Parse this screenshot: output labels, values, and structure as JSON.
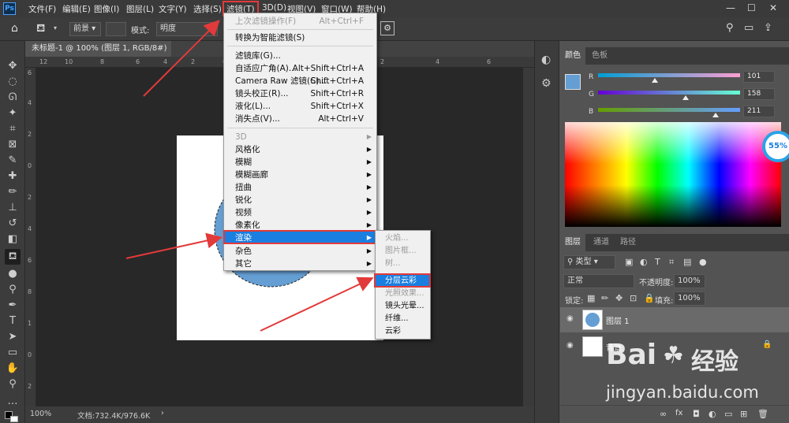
{
  "app": {
    "logo": "Ps"
  },
  "menubar": {
    "items": [
      "文件(F)",
      "编辑(E)",
      "图像(I)",
      "图层(L)",
      "文字(Y)",
      "选择(S)",
      "滤镜(T)",
      "3D(D)",
      "视图(V)",
      "窗口(W)",
      "帮助(H)"
    ],
    "window_controls": [
      "—",
      "☐",
      "✕"
    ]
  },
  "options": {
    "source_value": "前景",
    "mode_label": "模式:",
    "mode_value": "明度"
  },
  "document": {
    "tab_title": "未标题-1 @ 100% (图层 1, RGB/8#) *",
    "zoom": "100%",
    "doc_info": "文档:732.4K/976.6K",
    "ruler_h": [
      "12",
      "10",
      "8",
      "6",
      "4",
      "2",
      "0",
      "2",
      "4",
      "6"
    ],
    "ruler_v": [
      "6",
      "4",
      "2",
      "0",
      "2",
      "4",
      "6",
      "8",
      "1",
      "0",
      "2"
    ]
  },
  "filter_menu": {
    "items": [
      {
        "label": "上次滤镜操作(F)",
        "shortcut": "Alt+Ctrl+F",
        "disabled": true
      },
      {
        "label": "转换为智能滤镜(S)",
        "shortcut": ""
      },
      {
        "label": "滤镜库(G)...",
        "shortcut": ""
      },
      {
        "label": "自适应广角(A)...",
        "shortcut": "Alt+Shift+Ctrl+A"
      },
      {
        "label": "Camera Raw 滤镜(C)...",
        "shortcut": "Shift+Ctrl+A"
      },
      {
        "label": "镜头校正(R)...",
        "shortcut": "Shift+Ctrl+R"
      },
      {
        "label": "液化(L)...",
        "shortcut": "Shift+Ctrl+X"
      },
      {
        "label": "消失点(V)...",
        "shortcut": "Alt+Ctrl+V"
      },
      {
        "label": "3D",
        "disabled": true
      },
      {
        "label": "风格化"
      },
      {
        "label": "模糊"
      },
      {
        "label": "模糊画廊"
      },
      {
        "label": "扭曲"
      },
      {
        "label": "锐化"
      },
      {
        "label": "视频"
      },
      {
        "label": "像素化"
      },
      {
        "label": "渲染",
        "highlighted": true
      },
      {
        "label": "杂色"
      },
      {
        "label": "其它"
      }
    ]
  },
  "render_submenu": {
    "items": [
      {
        "label": "火焰...",
        "disabled": true
      },
      {
        "label": "图片框...",
        "disabled": true
      },
      {
        "label": "树...",
        "disabled": true
      },
      {
        "label": "分层云彩",
        "highlighted": true
      },
      {
        "label": "光照效果...",
        "disabled": true
      },
      {
        "label": "镜头光晕..."
      },
      {
        "label": "纤维..."
      },
      {
        "label": "云彩"
      }
    ]
  },
  "color_panel": {
    "tabs": [
      "颜色",
      "色板"
    ],
    "channels": [
      {
        "name": "R",
        "value": "101"
      },
      {
        "name": "G",
        "value": "158"
      },
      {
        "name": "B",
        "value": "211"
      }
    ],
    "foreground_color": "#659ed3",
    "progress_badge": "55%"
  },
  "layers_panel": {
    "tabs": [
      "图层",
      "通道",
      "路径"
    ],
    "filter_kind": "类型",
    "blend_mode": "正常",
    "opacity_label": "不透明度:",
    "opacity_value": "100%",
    "lock_label": "锁定:",
    "fill_label": "填充:",
    "fill_value": "100%",
    "layers": [
      {
        "name": "图层 1"
      },
      {
        "name": "背景"
      }
    ]
  },
  "watermark": {
    "brand": "Bai",
    "brand_suffix": "经验",
    "url": "jingyan.baidu.com"
  }
}
